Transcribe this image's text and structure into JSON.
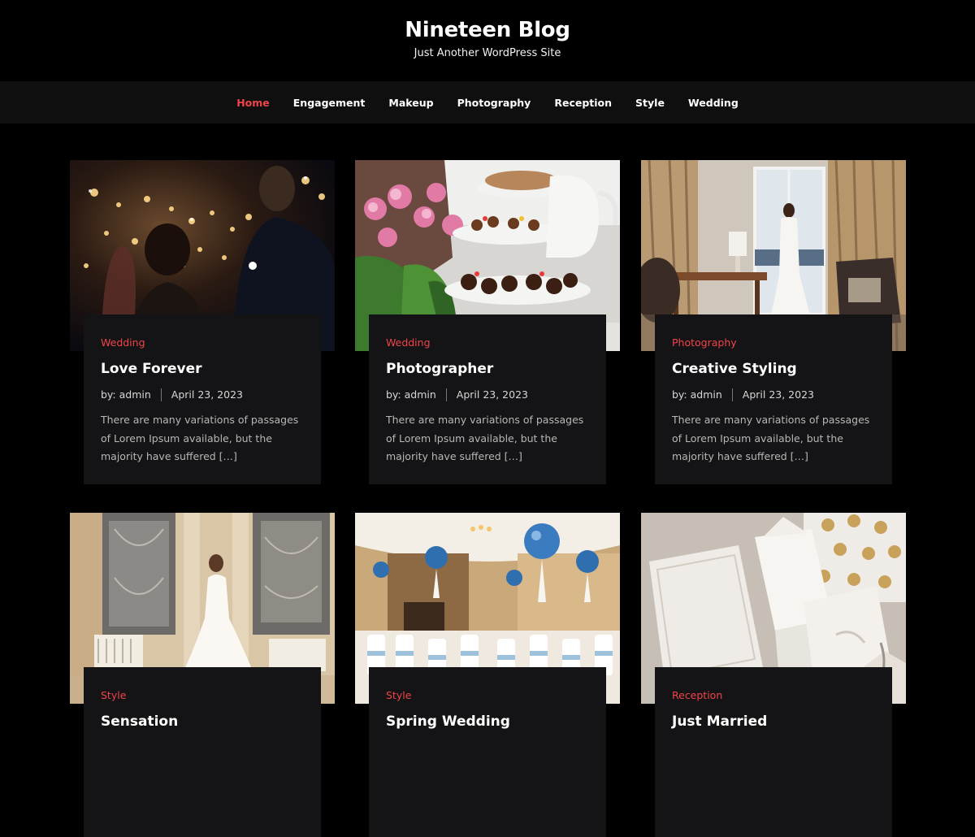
{
  "site": {
    "title": "Nineteen Blog",
    "tagline": "Just Another WordPress Site"
  },
  "nav": {
    "items": [
      {
        "label": "Home",
        "active": true
      },
      {
        "label": "Engagement"
      },
      {
        "label": "Makeup"
      },
      {
        "label": "Photography"
      },
      {
        "label": "Reception"
      },
      {
        "label": "Style"
      },
      {
        "label": "Wedding"
      }
    ]
  },
  "colors": {
    "accent": "#f0444a",
    "card_bg": "#141416",
    "nav_bg": "#0f0f10",
    "page_bg": "#000000"
  },
  "posts": [
    {
      "category": "Wedding",
      "title": "Love Forever",
      "author": "by: admin",
      "date": "April 23, 2023",
      "excerpt": "There are many variations of passages of Lorem Ipsum available, but the majority have suffered […]",
      "image": "couple-sparklers-night-photo"
    },
    {
      "category": "Wedding",
      "title": "Photographer",
      "author": "by: admin",
      "date": "April 23, 2023",
      "excerpt": "There are many variations of passages of Lorem Ipsum available, but the majority have suffered […]",
      "image": "dessert-tier-flowers-photo"
    },
    {
      "category": "Photography",
      "title": "Creative Styling",
      "author": "by: admin",
      "date": "April 23, 2023",
      "excerpt": "There are many variations of passages of Lorem Ipsum available, but the majority have suffered […]",
      "image": "bride-hotel-room-photo"
    },
    {
      "category": "Style",
      "title": "Sensation",
      "image": "bride-ornate-hall-photo"
    },
    {
      "category": "Style",
      "title": "Spring Wedding",
      "image": "banquet-hall-balloons-photo"
    },
    {
      "category": "Reception",
      "title": "Just Married",
      "image": "favor-boxes-photo"
    }
  ]
}
